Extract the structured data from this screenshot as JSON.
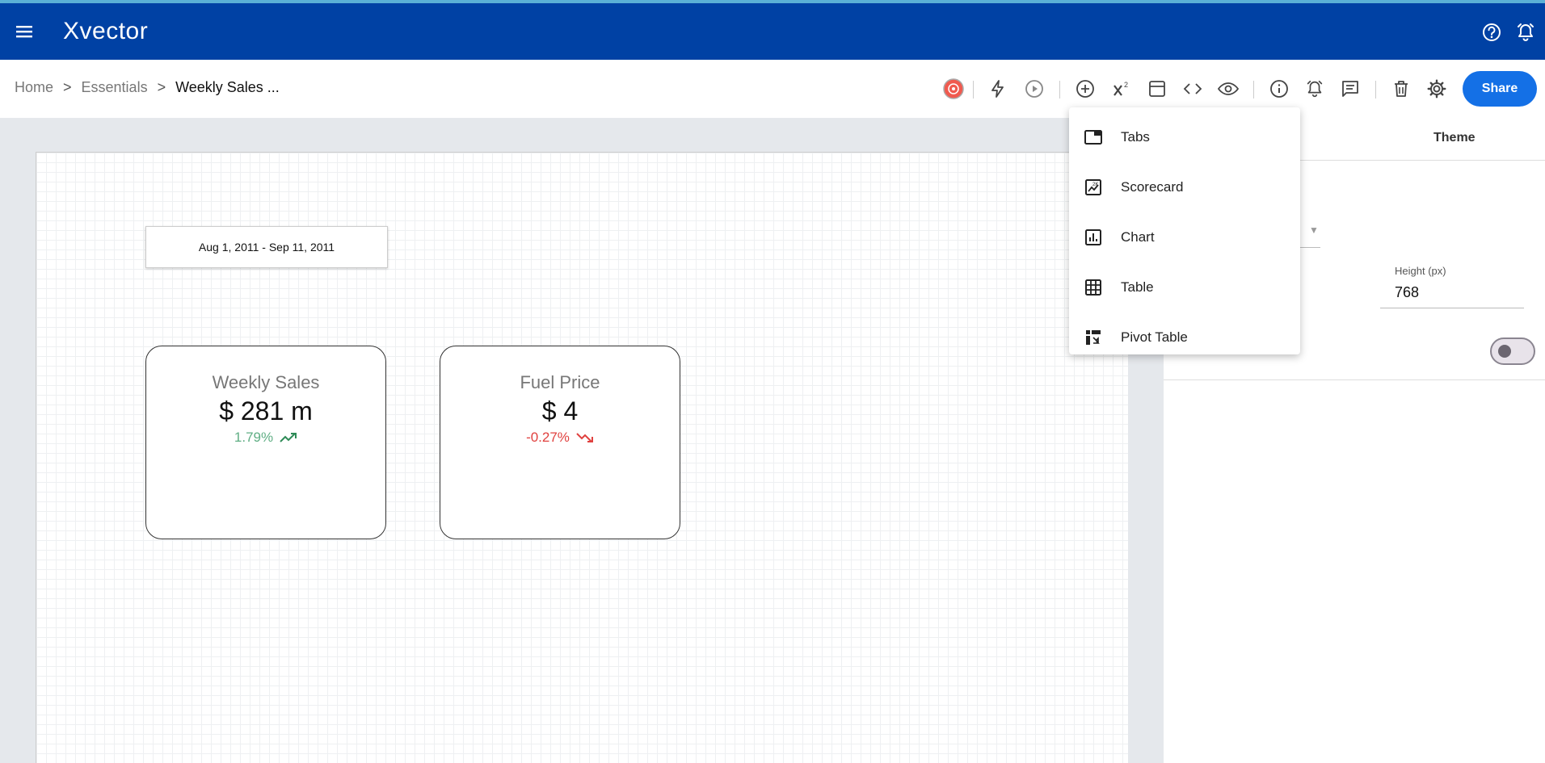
{
  "app": {
    "name": "Xvector"
  },
  "breadcrumb": {
    "home": "Home",
    "sep1": ">",
    "section": "Essentials",
    "sep2": ">",
    "current": "Weekly Sales ..."
  },
  "toolbar": {
    "share_label": "Share"
  },
  "canvas": {
    "date_range": "Aug 1, 2011 - Sep 11, 2011",
    "scorecards": [
      {
        "title": "Weekly Sales",
        "value": "$ 281 m",
        "delta": "1.79%",
        "trend": "up",
        "color": "#5fae84"
      },
      {
        "title": "Fuel Price",
        "value": "$ 4",
        "delta": "-0.27%",
        "trend": "down",
        "color": "#e0413f"
      }
    ]
  },
  "panel": {
    "tab_theme": "Theme",
    "height_label": "Height (px)",
    "height_value": "768"
  },
  "add_menu": {
    "items": [
      {
        "label": "Tabs",
        "icon": "tabs-icon"
      },
      {
        "label": "Scorecard",
        "icon": "scorecard-icon"
      },
      {
        "label": "Chart",
        "icon": "chart-icon"
      },
      {
        "label": "Table",
        "icon": "table-icon"
      },
      {
        "label": "Pivot Table",
        "icon": "pivot-table-icon"
      }
    ]
  },
  "colors": {
    "appbar": "#0041a4",
    "accent": "#1470e6"
  }
}
